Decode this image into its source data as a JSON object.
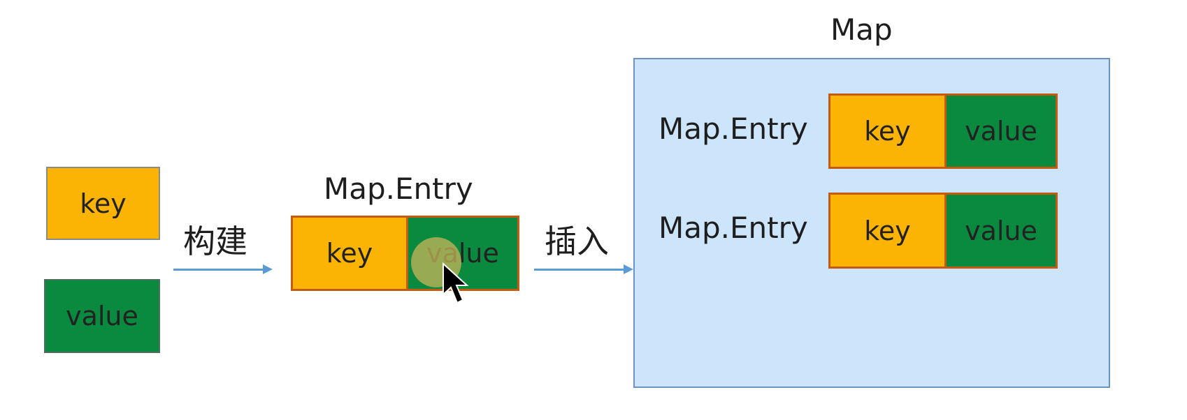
{
  "inputs": {
    "key_label": "key",
    "value_label": "value"
  },
  "build_arrow": {
    "label": "构建"
  },
  "entry": {
    "title": "Map.Entry",
    "key_label": "key",
    "value_label": "value"
  },
  "insert_arrow": {
    "label": "插入"
  },
  "map": {
    "title": "Map",
    "entries": [
      {
        "title": "Map.Entry",
        "key_label": "key",
        "value_label": "value"
      },
      {
        "title": "Map.Entry",
        "key_label": "key",
        "value_label": "value"
      }
    ]
  },
  "colors": {
    "key": "#fbb404",
    "value": "#0a8a3f",
    "entry_border": "#c55a11",
    "arrow": "#5b9bd5",
    "map_fill": "#cde5fb",
    "map_border": "#6a93c4"
  }
}
